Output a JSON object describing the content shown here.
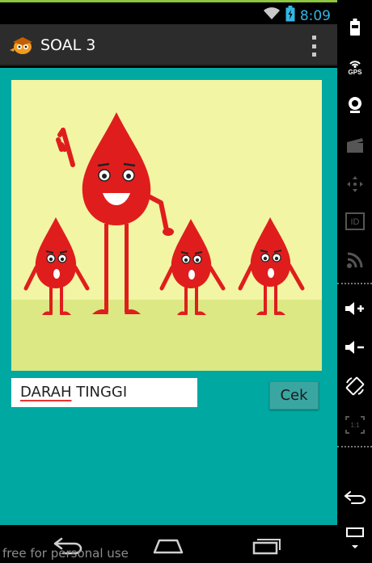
{
  "status_bar": {
    "time": "8:09",
    "icons": [
      "wifi-icon",
      "battery-icon"
    ]
  },
  "action_bar": {
    "title": "SOAL 3",
    "app_icon": "app-logo-icon",
    "overflow_icon": "overflow-menu-icon"
  },
  "question": {
    "image": "blood-drop-characters-illustration"
  },
  "answer": {
    "misspelled_word": "DARAH",
    "rest": " TINGGI"
  },
  "check_button": {
    "label": "Cek"
  },
  "nav_bar": {
    "icons": [
      "back-icon",
      "home-icon",
      "recent-apps-icon"
    ]
  },
  "watermark": "free for personal use",
  "side_panel": {
    "icons": [
      "battery-icon",
      "gps-icon",
      "camera-icon",
      "clapperboard-icon",
      "dpad-icon",
      "id-icon",
      "rss-icon",
      "volume-up-icon",
      "volume-down-icon",
      "rotate-icon",
      "scale-icon",
      "back-icon",
      "menu-icon"
    ],
    "gps_label": "GPS",
    "id_label": "ID",
    "scale_label": "1:1"
  },
  "colors": {
    "content_bg": "#00a8a2",
    "picture_bg": "#f2f5a3",
    "ground": "#dbe884",
    "drop": "#e01d1d",
    "status_time": "#33b5e5",
    "action_bar": "#2c2c2c",
    "button": "#3aa6a2"
  }
}
